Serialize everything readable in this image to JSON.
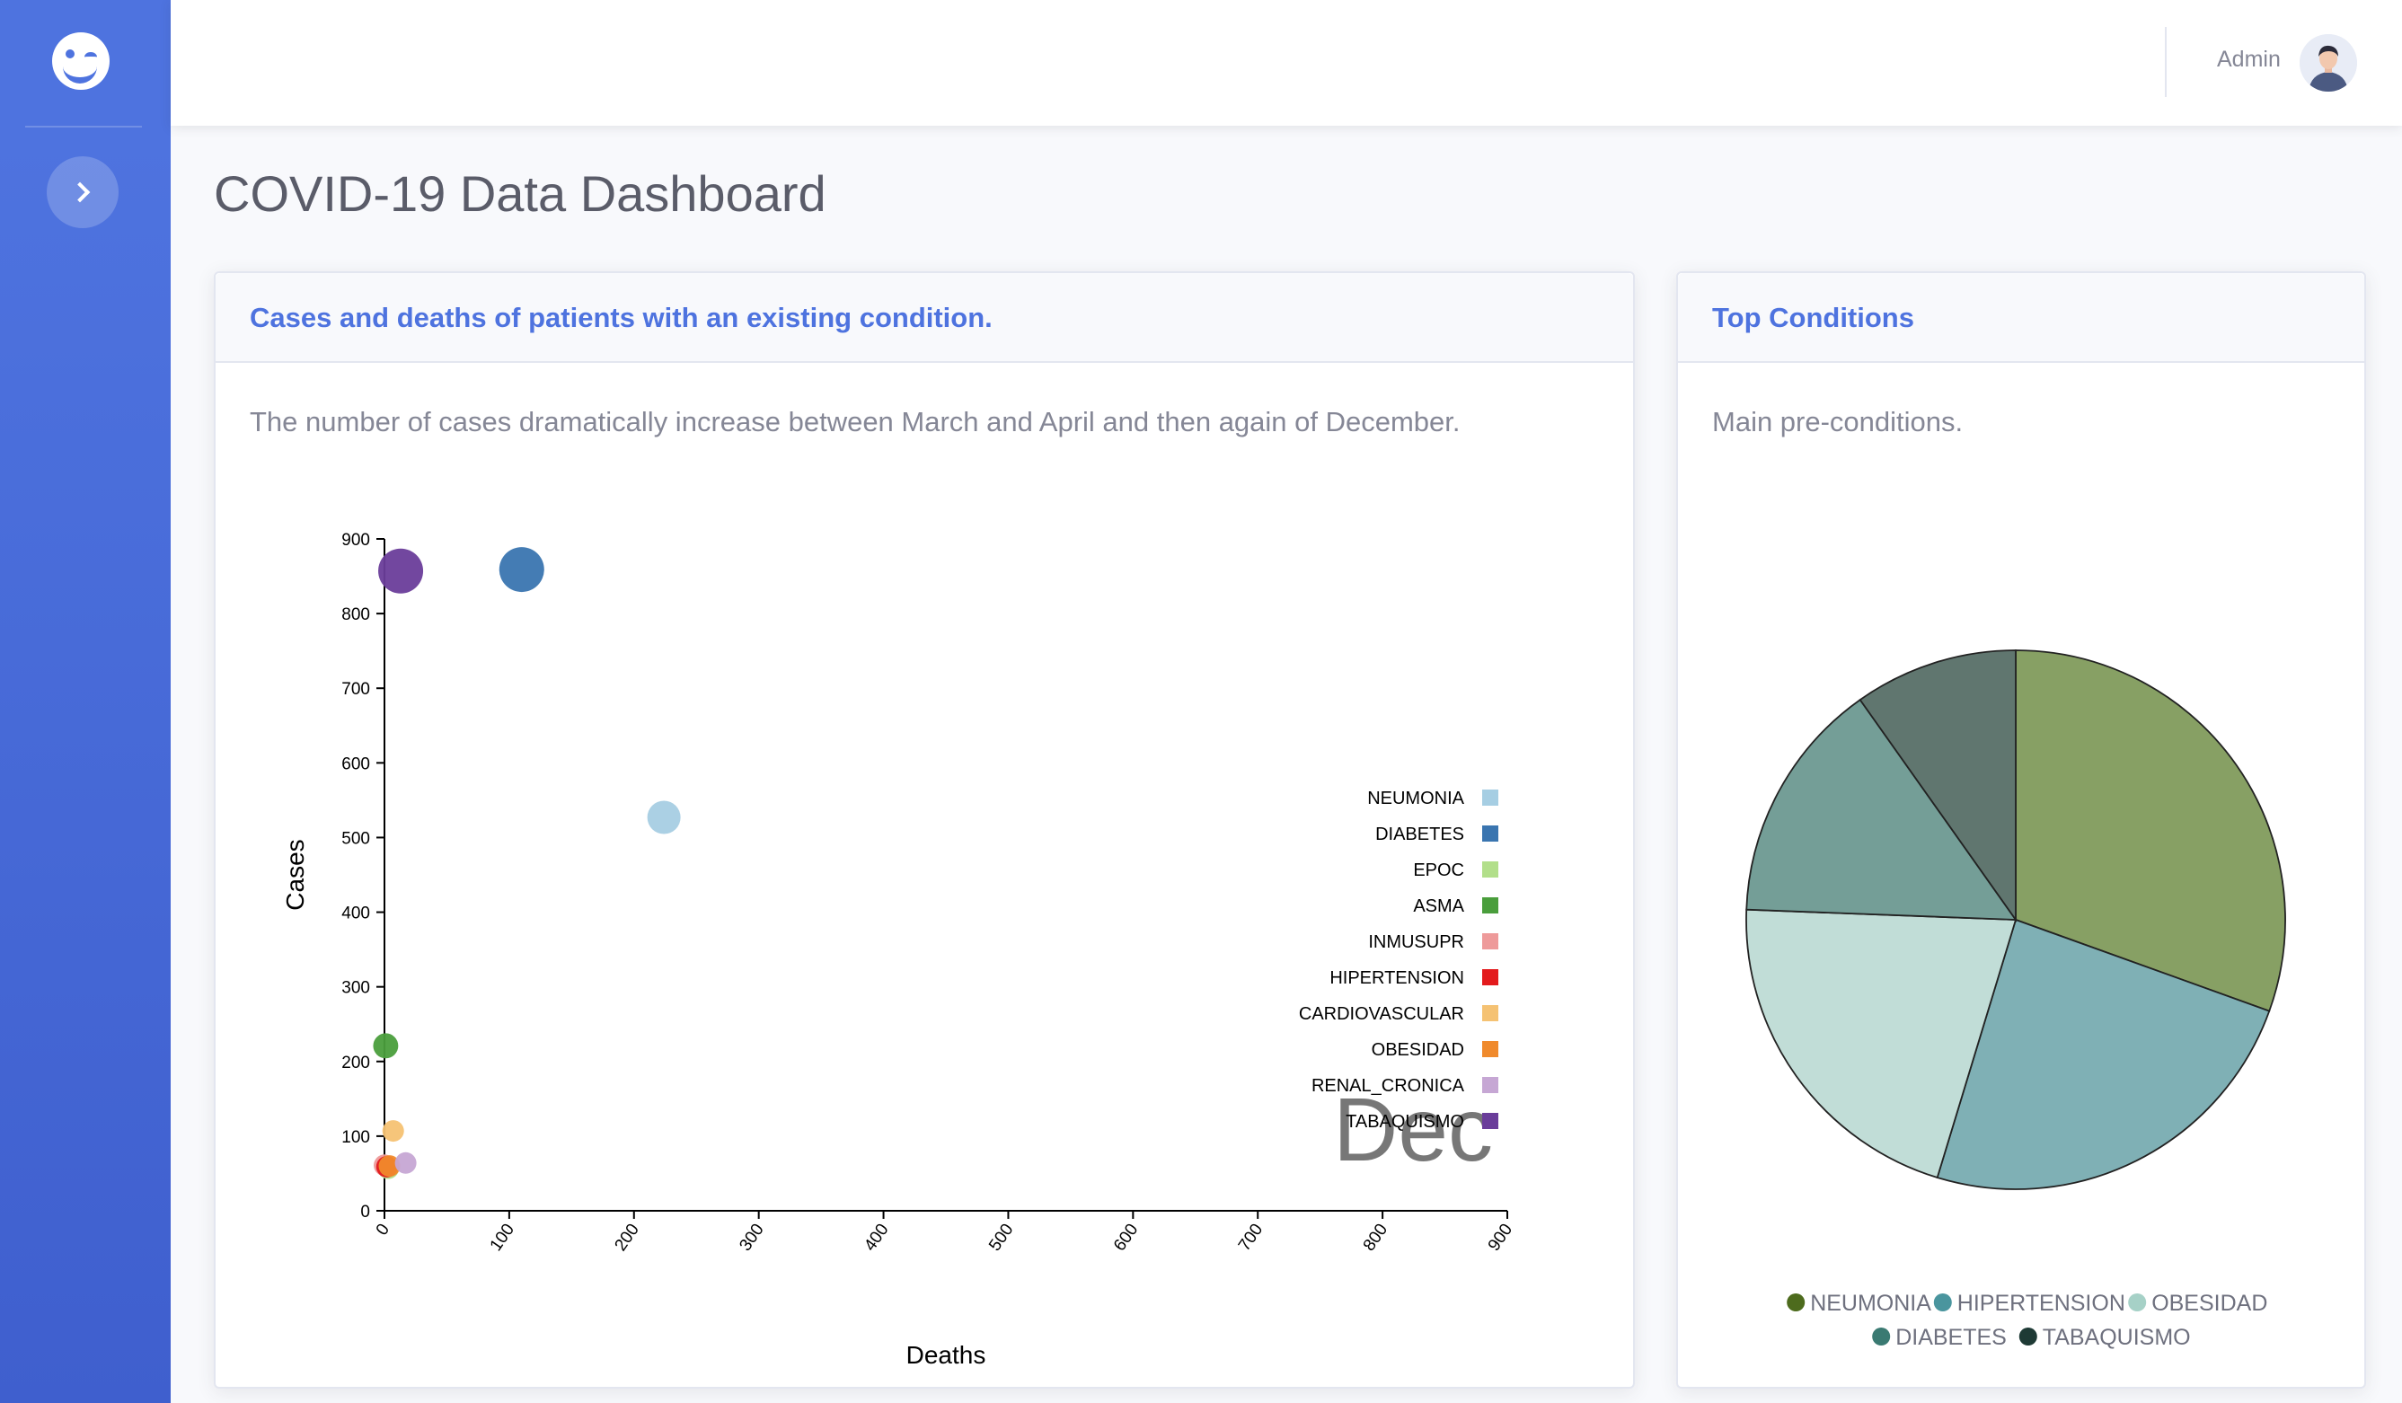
{
  "sidebar": {
    "brand_icon": "winking-smiley-logo",
    "toggle_icon": "chevron-right-icon"
  },
  "topbar": {
    "user_name": "Admin",
    "avatar_icon": "user-avatar-icon"
  },
  "page": {
    "title": "COVID-19 Data Dashboard"
  },
  "scatter_card": {
    "title": "Cases and deaths of patients with an existing condition.",
    "description": "The number of cases dramatically increase between March and April and then again of December."
  },
  "pie_card": {
    "title": "Top Conditions",
    "description": "Main pre-conditions."
  },
  "chart_data": [
    {
      "type": "scatter",
      "xlabel": "Deaths",
      "ylabel": "Cases",
      "xlim": [
        0,
        900
      ],
      "ylim": [
        0,
        900
      ],
      "xticks": [
        0,
        100,
        200,
        300,
        400,
        500,
        600,
        700,
        800,
        900
      ],
      "yticks": [
        0,
        100,
        200,
        300,
        400,
        500,
        600,
        700,
        800,
        900
      ],
      "annotation": "Dec",
      "legend_position": "right",
      "points": [
        {
          "name": "NEUMONIA",
          "color": "#a6cee3",
          "x": 224,
          "y": 527,
          "size": 2
        },
        {
          "name": "DIABETES",
          "color": "#3a75b0",
          "x": 110,
          "y": 859,
          "size": 3
        },
        {
          "name": "EPOC",
          "color": "#b2df8a",
          "x": 3,
          "y": 57,
          "size": 1
        },
        {
          "name": "ASMA",
          "color": "#4a9e3c",
          "x": 1,
          "y": 221,
          "size": 1.3
        },
        {
          "name": "INMUSUPR",
          "color": "#ee9a9a",
          "x": 0,
          "y": 61,
          "size": 1
        },
        {
          "name": "HIPERTENSION",
          "color": "#e31a1c",
          "x": 2,
          "y": 59,
          "size": 1
        },
        {
          "name": "CARDIOVASCULAR",
          "color": "#f5c273",
          "x": 7,
          "y": 107,
          "size": 1
        },
        {
          "name": "OBESIDAD",
          "color": "#f08a2c",
          "x": 4,
          "y": 60,
          "size": 1
        },
        {
          "name": "RENAL_CRONICA",
          "color": "#c6a7d4",
          "x": 17,
          "y": 64,
          "size": 1
        },
        {
          "name": "TABAQUISMO",
          "color": "#6a3d9a",
          "x": 13,
          "y": 857,
          "size": 3
        }
      ]
    },
    {
      "type": "pie",
      "slices": [
        {
          "label": "NEUMONIA",
          "value": 30.5,
          "color": "#87a064",
          "legend_color": "#4d6b1d"
        },
        {
          "label": "HIPERTENSION",
          "value": 24.2,
          "color": "#7fb0b5",
          "legend_color": "#4a959e"
        },
        {
          "label": "OBESIDAD",
          "value": 20.9,
          "color": "#c1ddd7",
          "legend_color": "#a6d1c7"
        },
        {
          "label": "DIABETES",
          "value": 14.6,
          "color": "#749e97",
          "legend_color": "#3a7a72"
        },
        {
          "label": "TABAQUISMO",
          "value": 9.8,
          "color": "#60766f",
          "legend_color": "#1e3a35"
        }
      ]
    }
  ]
}
